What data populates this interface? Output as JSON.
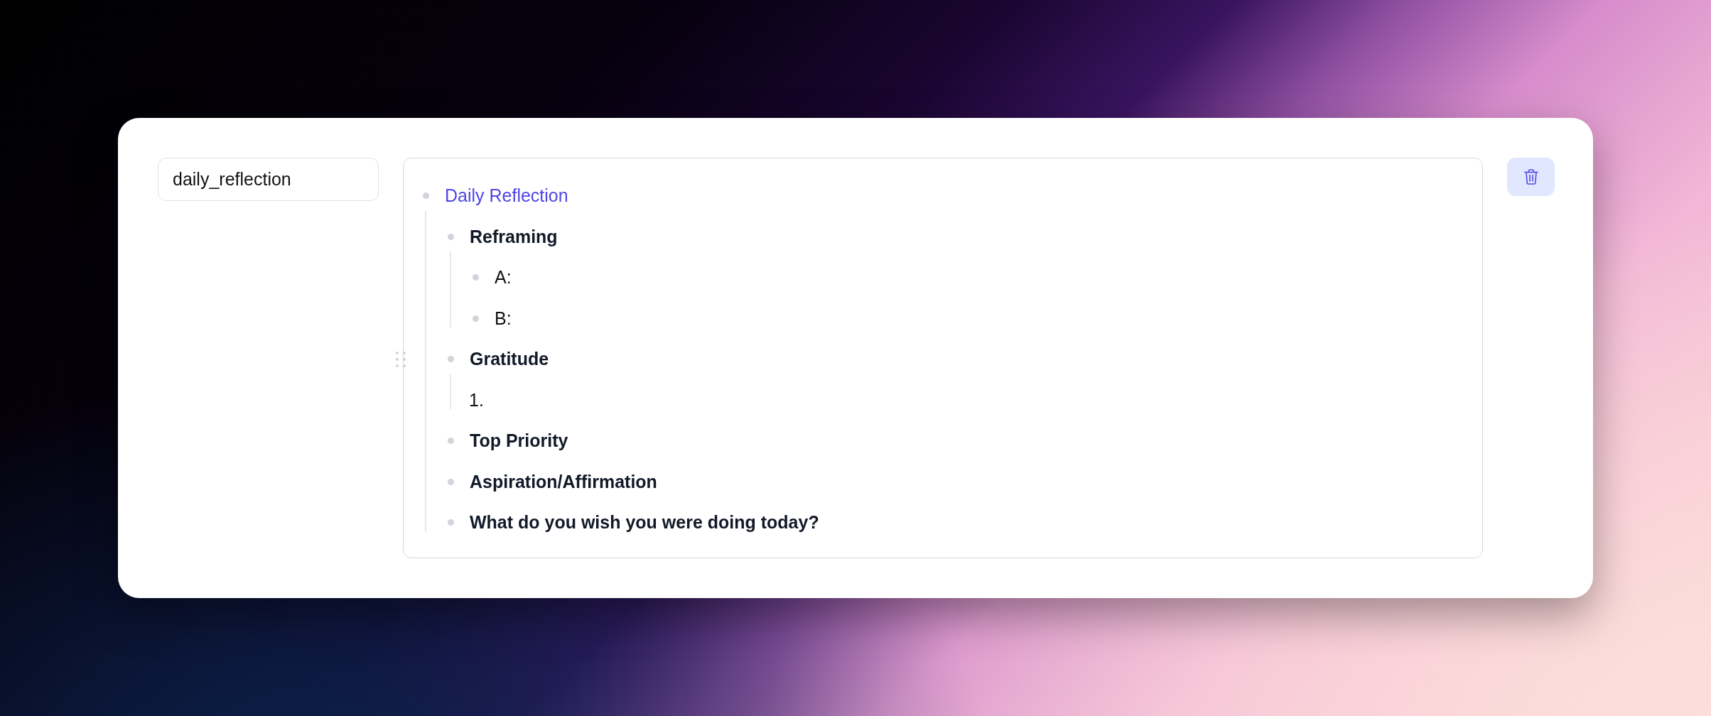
{
  "name_field": {
    "value": "daily_reflection"
  },
  "outline": [
    {
      "kind": "title",
      "text": "Daily Reflection",
      "hovered": false,
      "children": [
        {
          "kind": "heading",
          "text": "Reframing",
          "hovered": false,
          "children": [
            {
              "kind": "bullet",
              "text": "A:",
              "hovered": false
            },
            {
              "kind": "bullet",
              "text": "B:",
              "hovered": false
            }
          ]
        },
        {
          "kind": "heading",
          "text": "Gratitude",
          "hovered": true,
          "children": [
            {
              "kind": "numbered",
              "text": "1.",
              "hovered": false
            }
          ]
        },
        {
          "kind": "heading",
          "text": "Top Priority",
          "hovered": false
        },
        {
          "kind": "heading",
          "text": "Aspiration/Affirmation",
          "hovered": false
        },
        {
          "kind": "heading",
          "text": "What do you wish you were doing today?",
          "hovered": false
        }
      ]
    }
  ]
}
